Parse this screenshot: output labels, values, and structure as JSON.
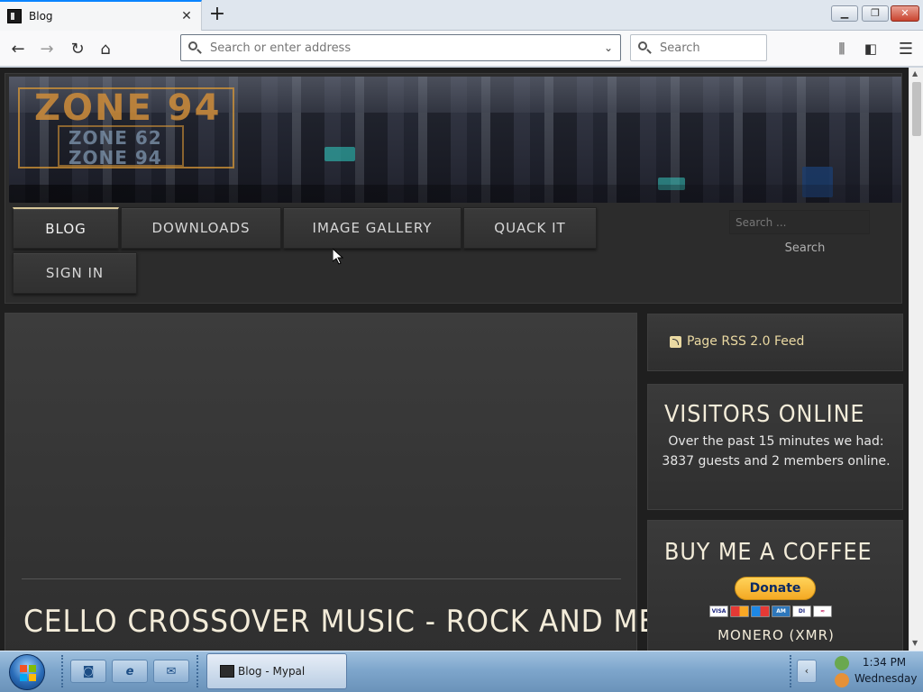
{
  "browser": {
    "tab_title": "Blog",
    "url_placeholder": "Search or enter address",
    "search_placeholder": "Search"
  },
  "site": {
    "logo_main": "ZONE 94",
    "logo_sub1": "ZONE 62",
    "logo_sub2": "ZONE 94",
    "menu": [
      "BLOG",
      "DOWNLOADS",
      "IMAGE GALLERY",
      "QUACK IT",
      "SIGN IN"
    ],
    "search_placeholder": "Search ...",
    "search_button": "Search"
  },
  "article": {
    "title": "CELLO CROSSOVER MUSIC - ROCK AND METAL"
  },
  "sidebar": {
    "rss_label": "Page RSS 2.0 Feed",
    "visitors_heading": "VISITORS ONLINE",
    "visitors_text": "Over the past 15 minutes we had: 3837 guests and 2 members online.",
    "coffee_heading": "BUY ME A COFFEE",
    "donate_label": "Donate",
    "monero_label": "MONERO (XMR)"
  },
  "taskbar": {
    "task_label": "Blog - Mypal",
    "time": "1:34 PM",
    "day": "Wednesday"
  },
  "colors": {
    "accent": "#0a84ff",
    "heading": "#f3ecd9",
    "rss_link": "#ead9a2",
    "page_bg": "#1f1f1f"
  }
}
